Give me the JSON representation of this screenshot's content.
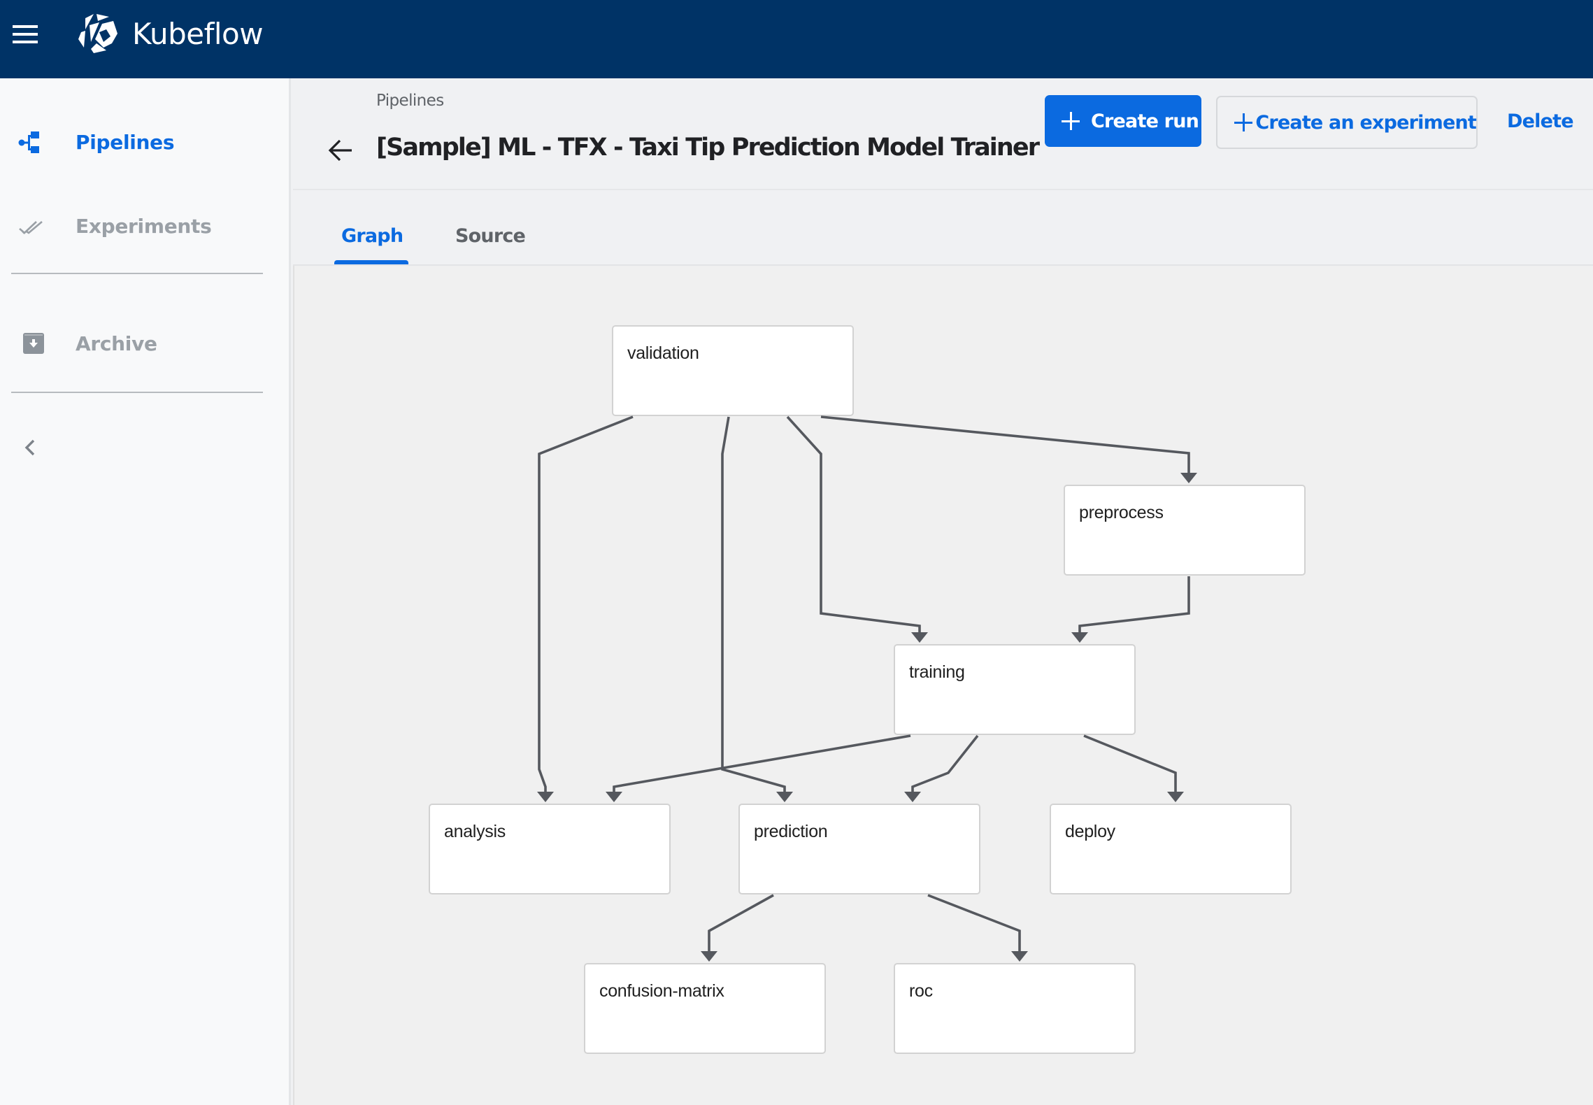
{
  "app": {
    "brand": "Kubeflow",
    "menu_icon": "hamburger-menu-icon",
    "logo_icon": "kubeflow-logo-icon"
  },
  "sidebar": {
    "items": [
      {
        "label": "Pipelines",
        "icon": "pipelines-icon",
        "active": true
      },
      {
        "label": "Experiments",
        "icon": "double-check-icon",
        "active": false
      },
      {
        "label": "Archive",
        "icon": "archive-icon",
        "active": false
      }
    ],
    "collapse_icon": "chevron-left-icon"
  },
  "header": {
    "breadcrumb": "Pipelines",
    "title": "[Sample] ML - TFX - Taxi Tip Prediction Model Trainer",
    "back_icon": "arrow-back-icon",
    "buttons": {
      "create_run": "Create run",
      "create_experiment": "Create an experiment",
      "delete": "Delete"
    }
  },
  "tabs": [
    {
      "label": "Graph",
      "active": true
    },
    {
      "label": "Source",
      "active": false
    }
  ],
  "colors": {
    "appbar": "#003366",
    "accent": "#0b6ae0",
    "edge": "#55585e",
    "muted_text": "#9aa0a6"
  },
  "graph": {
    "nodes": [
      {
        "id": "validation",
        "label": "validation"
      },
      {
        "id": "preprocess",
        "label": "preprocess"
      },
      {
        "id": "training",
        "label": "training"
      },
      {
        "id": "analysis",
        "label": "analysis"
      },
      {
        "id": "prediction",
        "label": "prediction"
      },
      {
        "id": "deploy",
        "label": "deploy"
      },
      {
        "id": "confusion-matrix",
        "label": "confusion-matrix"
      },
      {
        "id": "roc",
        "label": "roc"
      }
    ],
    "edges": [
      {
        "from": "validation",
        "to": "analysis"
      },
      {
        "from": "validation",
        "to": "prediction"
      },
      {
        "from": "validation",
        "to": "training"
      },
      {
        "from": "validation",
        "to": "preprocess"
      },
      {
        "from": "preprocess",
        "to": "training"
      },
      {
        "from": "training",
        "to": "analysis"
      },
      {
        "from": "training",
        "to": "prediction"
      },
      {
        "from": "training",
        "to": "deploy"
      },
      {
        "from": "prediction",
        "to": "confusion-matrix"
      },
      {
        "from": "prediction",
        "to": "roc"
      }
    ]
  }
}
